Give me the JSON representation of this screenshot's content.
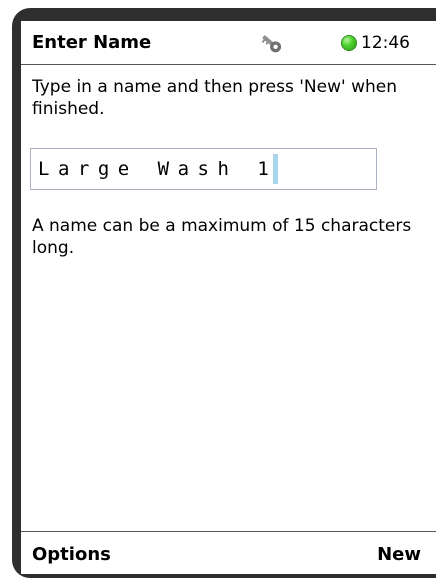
{
  "header": {
    "title": "Enter Name",
    "key_icon": "key-icon",
    "status_indicator_color": "#4fd12f",
    "time": "12:46"
  },
  "main": {
    "instruction": "Type in a name and then press 'New' when finished.",
    "name_input": {
      "value": "Large Wash 1"
    },
    "limit_note": "A name can be a maximum of 15 characters long."
  },
  "softkeys": {
    "left_label": "Options",
    "right_label": "New"
  }
}
